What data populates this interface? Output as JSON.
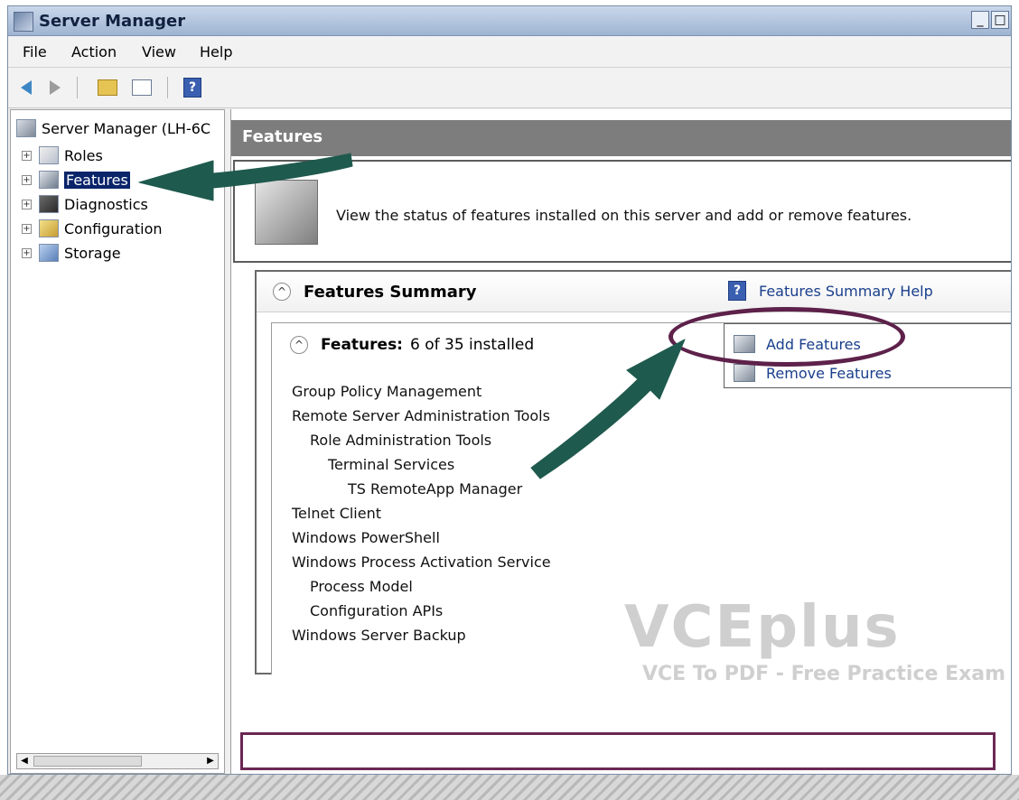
{
  "window": {
    "title": "Server Manager",
    "minimize": "_",
    "restore": "□"
  },
  "menu": [
    "File",
    "Action",
    "View",
    "Help"
  ],
  "toolbar": {
    "buttons": [
      "back-arrow-icon",
      "forward-arrow-icon",
      "up-folder-icon",
      "show-hide-console-tree-icon",
      "help-icon"
    ]
  },
  "tree": {
    "root": "Server Manager (LH-6C",
    "items": [
      {
        "label": "Roles",
        "icon": "roles-icon",
        "expander": "+"
      },
      {
        "label": "Features",
        "icon": "features-icon",
        "expander": "+"
      },
      {
        "label": "Diagnostics",
        "icon": "diagnostics-icon",
        "expander": "+"
      },
      {
        "label": "Configuration",
        "icon": "configuration-icon",
        "expander": "+"
      },
      {
        "label": "Storage",
        "icon": "storage-icon",
        "expander": "+"
      }
    ]
  },
  "header": {
    "title": "Features"
  },
  "description": "View the status of features installed on this server and add or remove features.",
  "summary": {
    "title": "Features Summary",
    "help_link": "Features Summary Help",
    "collapse_glyph": "^",
    "features_label": "Features:",
    "features_count": "6 of 35 installed",
    "actions": [
      "Add Features",
      "Remove Features"
    ],
    "items": [
      "Group Policy Management",
      "Remote Server Administration Tools",
      "Role Administration Tools",
      "Terminal Services",
      "TS RemoteApp Manager",
      "Telnet Client",
      "Windows PowerShell",
      "Windows Process Activation Service",
      "Process Model",
      "Configuration APIs",
      "Windows Server Backup"
    ]
  },
  "watermark": {
    "logo": "VCEplus",
    "subtitle": "VCE To PDF - Free Practice Exam"
  },
  "colors": {
    "annotation_arrow": "#1f5a4e",
    "annotation_circle": "#5d214a",
    "header_bar": "#7d7d7d",
    "link": "#1a3f8c"
  }
}
